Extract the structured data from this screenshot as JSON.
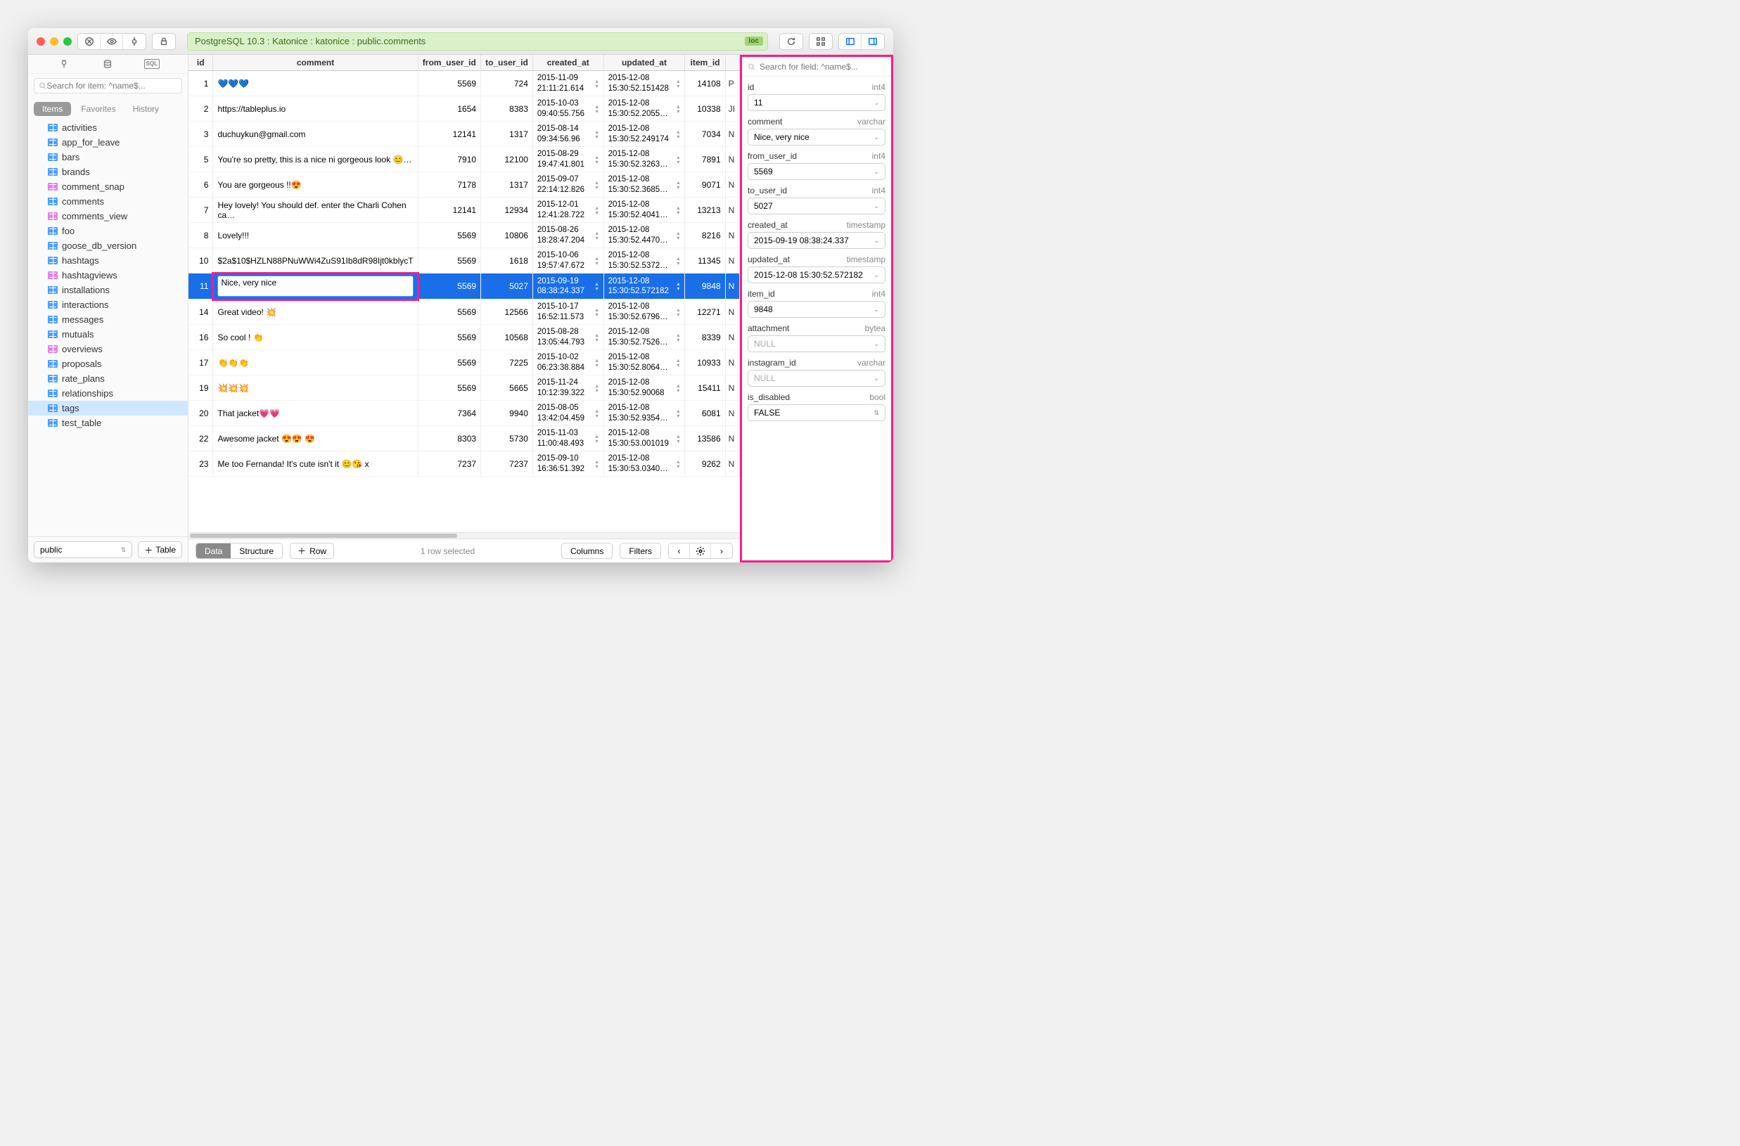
{
  "breadcrumb": "PostgreSQL 10.3 : Katonice : katonice : public.comments",
  "loc_badge": "loc",
  "sidebar": {
    "search_placeholder": "Search for item: ^name$...",
    "tabs": {
      "items": "Items",
      "favorites": "Favorites",
      "history": "History"
    },
    "tables": [
      {
        "name": "activities",
        "kind": "table"
      },
      {
        "name": "app_for_leave",
        "kind": "table"
      },
      {
        "name": "bars",
        "kind": "table"
      },
      {
        "name": "brands",
        "kind": "table"
      },
      {
        "name": "comment_snap",
        "kind": "view"
      },
      {
        "name": "comments",
        "kind": "table"
      },
      {
        "name": "comments_view",
        "kind": "view"
      },
      {
        "name": "foo",
        "kind": "table"
      },
      {
        "name": "goose_db_version",
        "kind": "table"
      },
      {
        "name": "hashtags",
        "kind": "table"
      },
      {
        "name": "hashtagviews",
        "kind": "view"
      },
      {
        "name": "installations",
        "kind": "table"
      },
      {
        "name": "interactions",
        "kind": "table"
      },
      {
        "name": "messages",
        "kind": "table"
      },
      {
        "name": "mutuals",
        "kind": "table"
      },
      {
        "name": "overviews",
        "kind": "view"
      },
      {
        "name": "proposals",
        "kind": "table"
      },
      {
        "name": "rate_plans",
        "kind": "table"
      },
      {
        "name": "relationships",
        "kind": "table"
      },
      {
        "name": "tags",
        "kind": "table",
        "selected": true
      },
      {
        "name": "test_table",
        "kind": "table"
      }
    ],
    "schema": "public",
    "add_table": "Table"
  },
  "columns": [
    "id",
    "comment",
    "from_user_id",
    "to_user_id",
    "created_at",
    "updated_at",
    "item_id"
  ],
  "rows": [
    {
      "id": 1,
      "comment": "💙💙💙",
      "from_user_id": 5569,
      "to_user_id": 724,
      "created_at": "2015-11-09 21:11:21.614",
      "updated_at": "2015-12-08 15:30:52.151428",
      "item_id": 14108,
      "extra": "P"
    },
    {
      "id": 2,
      "comment": "https://tableplus.io",
      "from_user_id": 1654,
      "to_user_id": 8383,
      "created_at": "2015-10-03 09:40:55.756",
      "updated_at": "2015-12-08 15:30:52.2055…",
      "item_id": 10338,
      "extra": "JI"
    },
    {
      "id": 3,
      "comment": "duchuykun@gmail.com",
      "from_user_id": 12141,
      "to_user_id": 1317,
      "created_at": "2015-08-14 09:34:56.96",
      "updated_at": "2015-12-08 15:30:52.249174",
      "item_id": 7034,
      "extra": "N"
    },
    {
      "id": 5,
      "comment": "You're so pretty, this is a nice ni gorgeous look 😊…",
      "from_user_id": 7910,
      "to_user_id": 12100,
      "created_at": "2015-08-29 19:47:41.801",
      "updated_at": "2015-12-08 15:30:52.3263…",
      "item_id": 7891,
      "extra": "N"
    },
    {
      "id": 6,
      "comment": "You are gorgeous !!😍",
      "from_user_id": 7178,
      "to_user_id": 1317,
      "created_at": "2015-09-07 22:14:12.826",
      "updated_at": "2015-12-08 15:30:52.3685…",
      "item_id": 9071,
      "extra": "N"
    },
    {
      "id": 7,
      "comment": "Hey lovely! You should def. enter the Charli Cohen ca…",
      "from_user_id": 12141,
      "to_user_id": 12934,
      "created_at": "2015-12-01 12:41:28.722",
      "updated_at": "2015-12-08 15:30:52.4041…",
      "item_id": 13213,
      "extra": "N"
    },
    {
      "id": 8,
      "comment": "Lovely!!!",
      "from_user_id": 5569,
      "to_user_id": 10806,
      "created_at": "2015-08-26 18:28:47.204",
      "updated_at": "2015-12-08 15:30:52.4470…",
      "item_id": 8216,
      "extra": "N"
    },
    {
      "id": 10,
      "comment": "$2a$10$HZLN88PNuWWi4ZuS91Ib8dR98Ijt0kblycT",
      "from_user_id": 5569,
      "to_user_id": 1618,
      "created_at": "2015-10-06 19:57:47.672",
      "updated_at": "2015-12-08 15:30:52.5372…",
      "item_id": 11345,
      "extra": "N"
    },
    {
      "id": 11,
      "comment": "Nice, very nice",
      "from_user_id": 5569,
      "to_user_id": 5027,
      "created_at": "2015-09-19 08:38:24.337",
      "updated_at": "2015-12-08 15:30:52.572182",
      "item_id": 9848,
      "extra": "N",
      "selected": true,
      "editing": true
    },
    {
      "id": 14,
      "comment": "Great video! 💥",
      "from_user_id": 5569,
      "to_user_id": 12566,
      "created_at": "2015-10-17 16:52:11.573",
      "updated_at": "2015-12-08 15:30:52.6796…",
      "item_id": 12271,
      "extra": "N"
    },
    {
      "id": 16,
      "comment": "So cool ! 👏",
      "from_user_id": 5569,
      "to_user_id": 10568,
      "created_at": "2015-08-28 13:05:44.793",
      "updated_at": "2015-12-08 15:30:52.7526…",
      "item_id": 8339,
      "extra": "N"
    },
    {
      "id": 17,
      "comment": "👏👏👏",
      "from_user_id": 5569,
      "to_user_id": 7225,
      "created_at": "2015-10-02 06:23:38.884",
      "updated_at": "2015-12-08 15:30:52.8064…",
      "item_id": 10933,
      "extra": "N"
    },
    {
      "id": 19,
      "comment": "💥💥💥",
      "from_user_id": 5569,
      "to_user_id": 5665,
      "created_at": "2015-11-24 10:12:39.322",
      "updated_at": "2015-12-08 15:30:52.90068",
      "item_id": 15411,
      "extra": "N"
    },
    {
      "id": 20,
      "comment": "That jacket💗💗",
      "from_user_id": 7364,
      "to_user_id": 9940,
      "created_at": "2015-08-05 13:42:04.459",
      "updated_at": "2015-12-08 15:30:52.9354…",
      "item_id": 6081,
      "extra": "N"
    },
    {
      "id": 22,
      "comment": "Awesome jacket 😍😍 😍",
      "from_user_id": 8303,
      "to_user_id": 5730,
      "created_at": "2015-11-03 11:00:48.493",
      "updated_at": "2015-12-08 15:30:53.001019",
      "item_id": 13586,
      "extra": "N"
    },
    {
      "id": 23,
      "comment": "Me too Fernanda! It's cute isn't it 😊😘 x",
      "from_user_id": 7237,
      "to_user_id": 7237,
      "created_at": "2015-09-10 16:36:51.392",
      "updated_at": "2015-12-08 15:30:53.0340…",
      "item_id": 9262,
      "extra": "N"
    }
  ],
  "footer": {
    "data": "Data",
    "structure": "Structure",
    "row": "Row",
    "status": "1 row selected",
    "columns": "Columns",
    "filters": "Filters"
  },
  "inspector": {
    "search_placeholder": "Search for field: ^name$...",
    "fields": [
      {
        "name": "id",
        "type": "int4",
        "value": "11"
      },
      {
        "name": "comment",
        "type": "varchar",
        "value": "Nice, very nice"
      },
      {
        "name": "from_user_id",
        "type": "int4",
        "value": "5569"
      },
      {
        "name": "to_user_id",
        "type": "int4",
        "value": "5027"
      },
      {
        "name": "created_at",
        "type": "timestamp",
        "value": "2015-09-19 08:38:24.337"
      },
      {
        "name": "updated_at",
        "type": "timestamp",
        "value": "2015-12-08 15:30:52.572182"
      },
      {
        "name": "item_id",
        "type": "int4",
        "value": "9848"
      },
      {
        "name": "attachment",
        "type": "bytea",
        "value": "NULL",
        "null": true
      },
      {
        "name": "instagram_id",
        "type": "varchar",
        "value": "NULL",
        "null": true
      },
      {
        "name": "is_disabled",
        "type": "bool",
        "value": "FALSE",
        "stepper": true
      }
    ]
  }
}
